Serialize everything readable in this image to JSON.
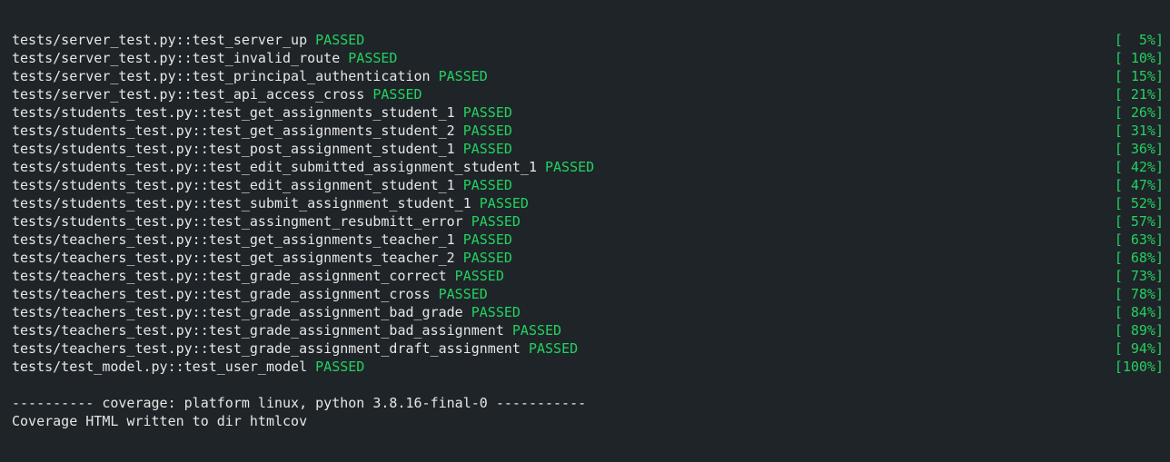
{
  "colors": {
    "background": "#1f2428",
    "text": "#e6e6e6",
    "passed": "#23d160"
  },
  "tests": [
    {
      "name": "tests/server_test.py::test_server_up",
      "status": "PASSED",
      "progress": "[  5%]"
    },
    {
      "name": "tests/server_test.py::test_invalid_route",
      "status": "PASSED",
      "progress": "[ 10%]"
    },
    {
      "name": "tests/server_test.py::test_principal_authentication",
      "status": "PASSED",
      "progress": "[ 15%]"
    },
    {
      "name": "tests/server_test.py::test_api_access_cross",
      "status": "PASSED",
      "progress": "[ 21%]"
    },
    {
      "name": "tests/students_test.py::test_get_assignments_student_1",
      "status": "PASSED",
      "progress": "[ 26%]"
    },
    {
      "name": "tests/students_test.py::test_get_assignments_student_2",
      "status": "PASSED",
      "progress": "[ 31%]"
    },
    {
      "name": "tests/students_test.py::test_post_assignment_student_1",
      "status": "PASSED",
      "progress": "[ 36%]"
    },
    {
      "name": "tests/students_test.py::test_edit_submitted_assignment_student_1",
      "status": "PASSED",
      "progress": "[ 42%]"
    },
    {
      "name": "tests/students_test.py::test_edit_assignment_student_1",
      "status": "PASSED",
      "progress": "[ 47%]"
    },
    {
      "name": "tests/students_test.py::test_submit_assignment_student_1",
      "status": "PASSED",
      "progress": "[ 52%]"
    },
    {
      "name": "tests/students_test.py::test_assingment_resubmitt_error",
      "status": "PASSED",
      "progress": "[ 57%]"
    },
    {
      "name": "tests/teachers_test.py::test_get_assignments_teacher_1",
      "status": "PASSED",
      "progress": "[ 63%]"
    },
    {
      "name": "tests/teachers_test.py::test_get_assignments_teacher_2",
      "status": "PASSED",
      "progress": "[ 68%]"
    },
    {
      "name": "tests/teachers_test.py::test_grade_assignment_correct",
      "status": "PASSED",
      "progress": "[ 73%]"
    },
    {
      "name": "tests/teachers_test.py::test_grade_assignment_cross",
      "status": "PASSED",
      "progress": "[ 78%]"
    },
    {
      "name": "tests/teachers_test.py::test_grade_assignment_bad_grade",
      "status": "PASSED",
      "progress": "[ 84%]"
    },
    {
      "name": "tests/teachers_test.py::test_grade_assignment_bad_assignment",
      "status": "PASSED",
      "progress": "[ 89%]"
    },
    {
      "name": "tests/teachers_test.py::test_grade_assignment_draft_assignment",
      "status": "PASSED",
      "progress": "[ 94%]"
    },
    {
      "name": "tests/test_model.py::test_user_model",
      "status": "PASSED",
      "progress": "[100%]"
    }
  ],
  "coverage": {
    "header": "---------- coverage: platform linux, python 3.8.16-final-0 -----------",
    "message": "Coverage HTML written to dir htmlcov"
  }
}
